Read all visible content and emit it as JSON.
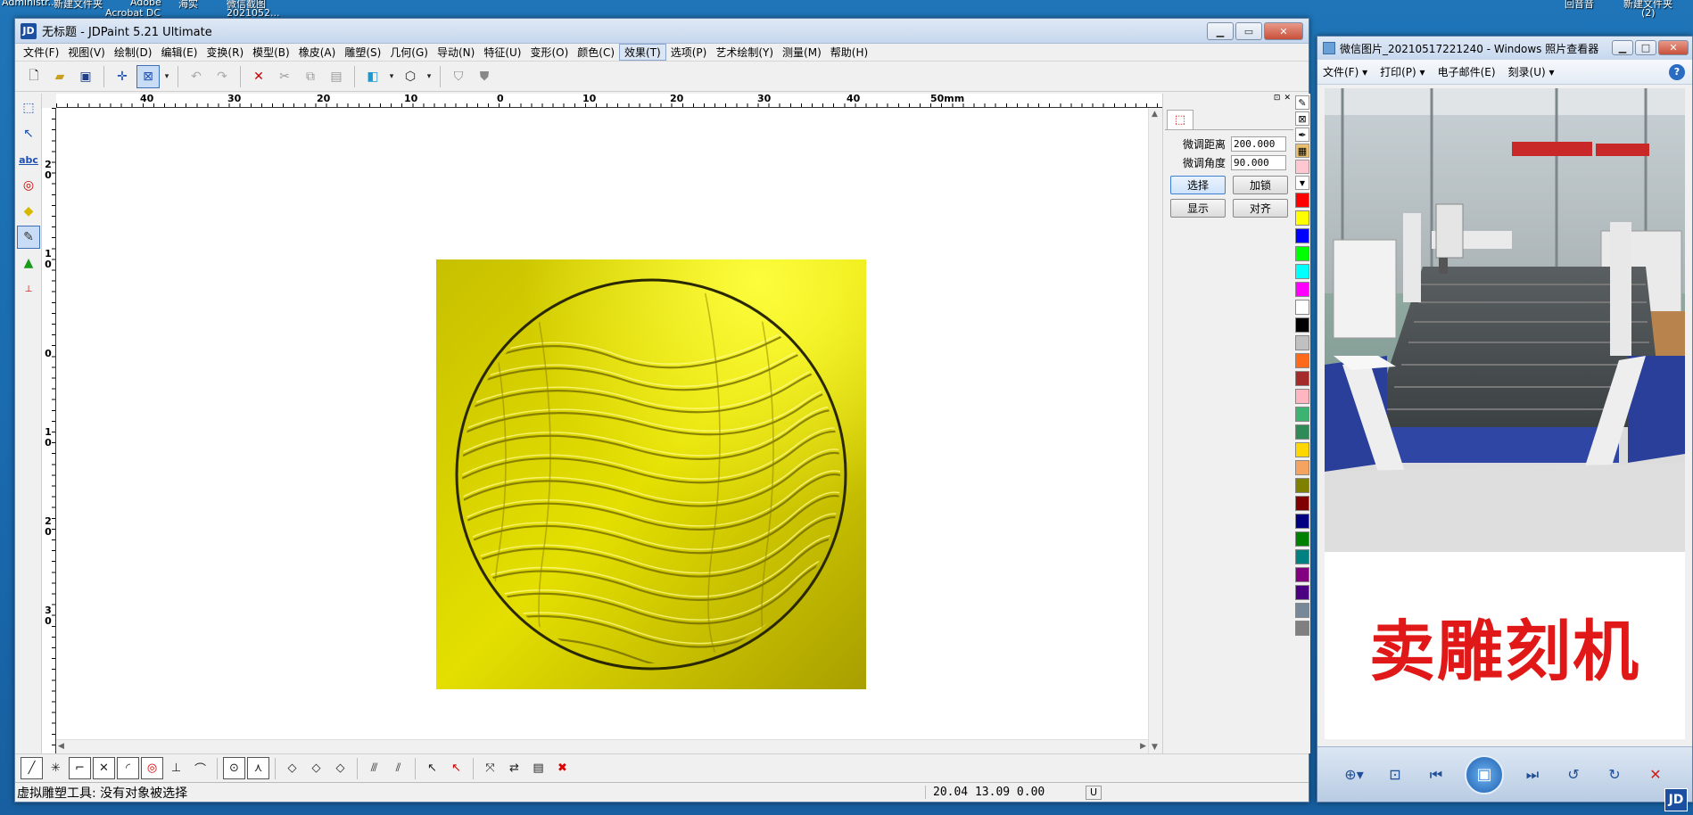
{
  "desktop": {
    "labels": [
      "Administr...",
      "新建文件夹",
      "Adobe",
      "Acrobat DC",
      "海实",
      "微信截图",
      "2021052...",
      "回音音",
      "新建文件夹",
      "(2)"
    ]
  },
  "jdpaint": {
    "title": "无标题 - JDPaint 5.21 Ultimate",
    "icon": "JD",
    "menu": [
      "文件(F)",
      "视图(V)",
      "绘制(D)",
      "编辑(E)",
      "变换(R)",
      "模型(B)",
      "橡皮(A)",
      "雕塑(S)",
      "几何(G)",
      "导动(N)",
      "特征(U)",
      "变形(O)",
      "颜色(C)",
      "效果(T)",
      "选项(P)",
      "艺术绘制(Y)",
      "测量(M)",
      "帮助(H)"
    ],
    "active_menu_index": 13,
    "ruler_top_labels": [
      "40",
      "30",
      "20",
      "10",
      "0",
      "10",
      "20",
      "30",
      "40",
      "50mm"
    ],
    "ruler_left_labels": [
      "2 0",
      "1 0",
      "0",
      "1 0",
      "2 0",
      "3 0"
    ],
    "panel": {
      "fine_distance_label": "微调距离",
      "fine_distance_value": "200.000",
      "fine_angle_label": "微调角度",
      "fine_angle_value": "90.000",
      "btn_select": "选择",
      "btn_lock": "加锁",
      "btn_show": "显示",
      "btn_align": "对齐"
    },
    "palette_colors": [
      "#ff0000",
      "#ffff00",
      "#0000ff",
      "#00ff00",
      "#00ffff",
      "#ff00ff",
      "#ffffff",
      "#000000",
      "#c0c0c0",
      "#ff6a1a",
      "#a52a2a",
      "#ffb6c1",
      "#3cb371",
      "#2e8b57",
      "#ffd700",
      "#f4a460",
      "#808000",
      "#800000",
      "#000080",
      "#008000",
      "#008080",
      "#800080",
      "#4b0082",
      "#778899",
      "#808080"
    ],
    "status": {
      "message": "虚拟雕塑工具: 没有对象被选择",
      "coords": "20.04 13.09 0.00",
      "unit": "U"
    }
  },
  "photo_viewer": {
    "title": "微信图片_20210517221240 - Windows 照片查看器",
    "menu": [
      "文件(F) ▾",
      "打印(P) ▾",
      "电子邮件(E)",
      "刻录(U) ▾"
    ],
    "help": "?",
    "caption": "卖雕刻机"
  },
  "icons": {
    "close": "✕",
    "minimize": "▭",
    "maximize": "□"
  }
}
